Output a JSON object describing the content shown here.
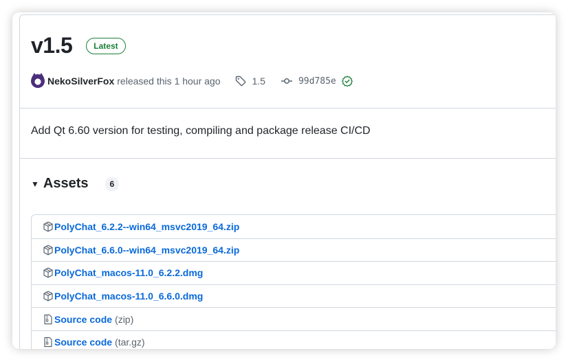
{
  "release": {
    "version": "v1.5",
    "badge": "Latest",
    "author": "NekoSilverFox",
    "released_text": "released this 1 hour ago",
    "tag": "1.5",
    "commit": "99d785e",
    "description": "Add Qt 6.60 version for testing, compiling and package release CI/CD"
  },
  "assets": {
    "title": "Assets",
    "count": "6",
    "items": [
      {
        "name": "PolyChat_6.2.2--win64_msvc2019_64.zip",
        "suffix": "",
        "icon": "package-icon"
      },
      {
        "name": "PolyChat_6.6.0--win64_msvc2019_64.zip",
        "suffix": "",
        "icon": "package-icon"
      },
      {
        "name": "PolyChat_macos-11.0_6.2.2.dmg",
        "suffix": "",
        "icon": "package-icon"
      },
      {
        "name": "PolyChat_macos-11.0_6.6.0.dmg",
        "suffix": "",
        "icon": "package-icon"
      },
      {
        "name": "Source code",
        "suffix": "(zip)",
        "icon": "file-zip-icon"
      },
      {
        "name": "Source code",
        "suffix": "(tar.gz)",
        "icon": "file-zip-icon"
      }
    ]
  },
  "colors": {
    "link": "#0969da",
    "success": "#1a7f37",
    "border": "#d0d7de",
    "muted": "#59636e"
  }
}
